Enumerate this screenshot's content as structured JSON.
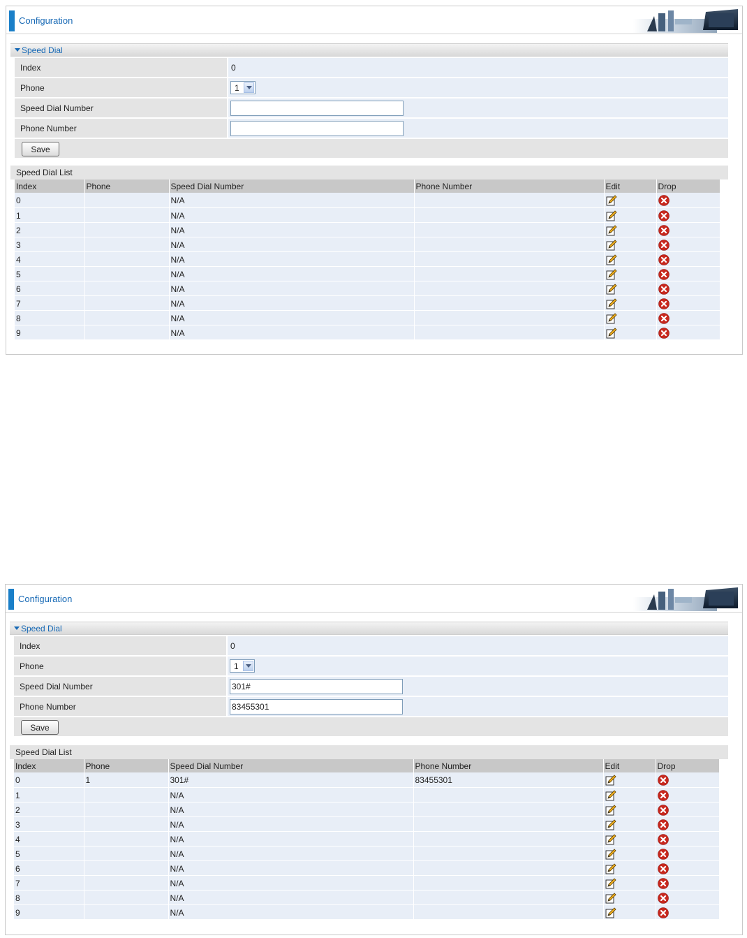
{
  "panels": [
    {
      "header": {
        "title": "Configuration"
      },
      "section_title": "Speed Dial",
      "form": {
        "index_label": "Index",
        "index_value": "0",
        "phone_label": "Phone",
        "phone_selected": "1",
        "speed_dial_label": "Speed Dial Number",
        "speed_dial_value": "",
        "phone_number_label": "Phone Number",
        "phone_number_value": "",
        "save_label": "Save"
      },
      "list": {
        "title": "Speed Dial List",
        "columns": [
          "Index",
          "Phone",
          "Speed Dial Number",
          "Phone Number",
          "Edit",
          "Drop"
        ],
        "rows": [
          {
            "index": "0",
            "phone": "",
            "speed_dial": "N/A",
            "phone_number": ""
          },
          {
            "index": "1",
            "phone": "",
            "speed_dial": "N/A",
            "phone_number": ""
          },
          {
            "index": "2",
            "phone": "",
            "speed_dial": "N/A",
            "phone_number": ""
          },
          {
            "index": "3",
            "phone": "",
            "speed_dial": "N/A",
            "phone_number": ""
          },
          {
            "index": "4",
            "phone": "",
            "speed_dial": "N/A",
            "phone_number": ""
          },
          {
            "index": "5",
            "phone": "",
            "speed_dial": "N/A",
            "phone_number": ""
          },
          {
            "index": "6",
            "phone": "",
            "speed_dial": "N/A",
            "phone_number": ""
          },
          {
            "index": "7",
            "phone": "",
            "speed_dial": "N/A",
            "phone_number": ""
          },
          {
            "index": "8",
            "phone": "",
            "speed_dial": "N/A",
            "phone_number": ""
          },
          {
            "index": "9",
            "phone": "",
            "speed_dial": "N/A",
            "phone_number": ""
          }
        ]
      }
    },
    {
      "header": {
        "title": "Configuration"
      },
      "section_title": "Speed Dial",
      "form": {
        "index_label": "Index",
        "index_value": "0",
        "phone_label": "Phone",
        "phone_selected": "1",
        "speed_dial_label": "Speed Dial Number",
        "speed_dial_value": "301#",
        "phone_number_label": "Phone Number",
        "phone_number_value": "83455301",
        "save_label": "Save"
      },
      "list": {
        "title": "Speed Dial List",
        "columns": [
          "Index",
          "Phone",
          "Speed Dial Number",
          "Phone Number",
          "Edit",
          "Drop"
        ],
        "rows": [
          {
            "index": "0",
            "phone": "1",
            "speed_dial": "301#",
            "phone_number": "83455301"
          },
          {
            "index": "1",
            "phone": "",
            "speed_dial": "N/A",
            "phone_number": ""
          },
          {
            "index": "2",
            "phone": "",
            "speed_dial": "N/A",
            "phone_number": ""
          },
          {
            "index": "3",
            "phone": "",
            "speed_dial": "N/A",
            "phone_number": ""
          },
          {
            "index": "4",
            "phone": "",
            "speed_dial": "N/A",
            "phone_number": ""
          },
          {
            "index": "5",
            "phone": "",
            "speed_dial": "N/A",
            "phone_number": ""
          },
          {
            "index": "6",
            "phone": "",
            "speed_dial": "N/A",
            "phone_number": ""
          },
          {
            "index": "7",
            "phone": "",
            "speed_dial": "N/A",
            "phone_number": ""
          },
          {
            "index": "8",
            "phone": "",
            "speed_dial": "N/A",
            "phone_number": ""
          },
          {
            "index": "9",
            "phone": "",
            "speed_dial": "N/A",
            "phone_number": ""
          }
        ]
      }
    }
  ],
  "icons": {
    "edit": "edit-pencil-icon",
    "drop": "drop-x-icon"
  },
  "colors": {
    "accent": "#1a7fc8",
    "title_text": "#1769b5",
    "drop_red": "#c8281e"
  }
}
